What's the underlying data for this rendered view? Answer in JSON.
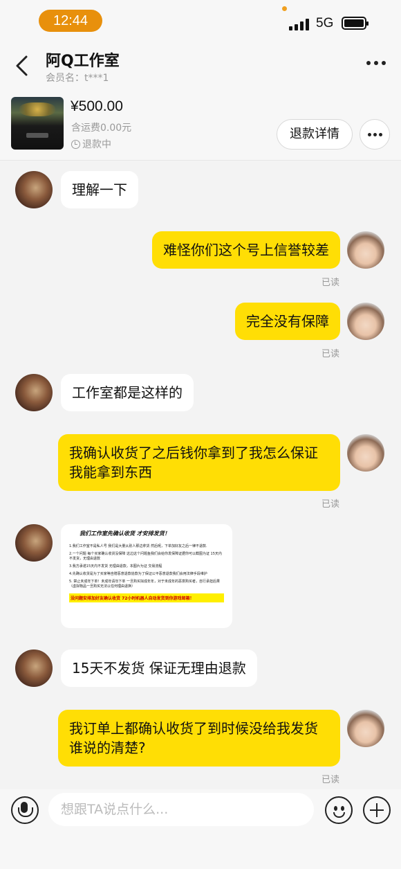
{
  "status_bar": {
    "time": "12:44",
    "network": "5G",
    "time_pill_color": "#e8900c"
  },
  "header": {
    "title": "阿Q工作室",
    "member": "会员名：t***1"
  },
  "product": {
    "price": "¥500.00",
    "shipping": "含运费0.00元",
    "status": "退款中",
    "refund_button": "退款详情"
  },
  "messages": [
    {
      "side": "left",
      "text": "理解一下"
    },
    {
      "side": "right",
      "text": "难怪你们这个号上信誉较差",
      "read": "已读"
    },
    {
      "side": "right",
      "text": "完全没有保障",
      "read": "已读"
    },
    {
      "side": "left",
      "text": "工作室都是这样的"
    },
    {
      "side": "right",
      "text": "我确认收货了之后钱你拿到了我怎么保证我能拿到东西",
      "read": "已读"
    },
    {
      "side": "left",
      "type": "image"
    },
    {
      "side": "left",
      "text": "15天不发货 保证无理由退款"
    },
    {
      "side": "right",
      "text": "我订单上都确认收货了到时候没给我发货谁说的清楚?",
      "read": "已读"
    }
  ],
  "notice_image": {
    "title": "我们工作室先确认收货 才安排发货！",
    "lines": [
      "1.我们工作室不是私人号 我们是大量从别人那边拿货 然后呢，下单加好友之后一律不退款.",
      "2.一个问题 每个买家确认收货没保障 这边这个问题鱼我们会给你发保障证据你可以截图为证 15天内不发货，无理由退款",
      "3.我方承诺15天内不发货 无理由退款，本图片为证 交易流程",
      "4.先确认收货是为了买家等自赠恶意退款追款为了保证公平恶意退款我们会用法律手段维护",
      "5. 禁止未成年下单！未成年请勿下单 一旦购买拟成年年，对于未成年的恶意购买者，自行承担后果（虚拟物品一旦购买无法以任何理由退换）"
    ],
    "highlight": "没问题安排加好友确认收货 72小时机器人自动发货到你游戏邮箱！"
  },
  "input_bar": {
    "placeholder": "想跟TA说点什么..."
  },
  "accent_color": "#ffde05"
}
